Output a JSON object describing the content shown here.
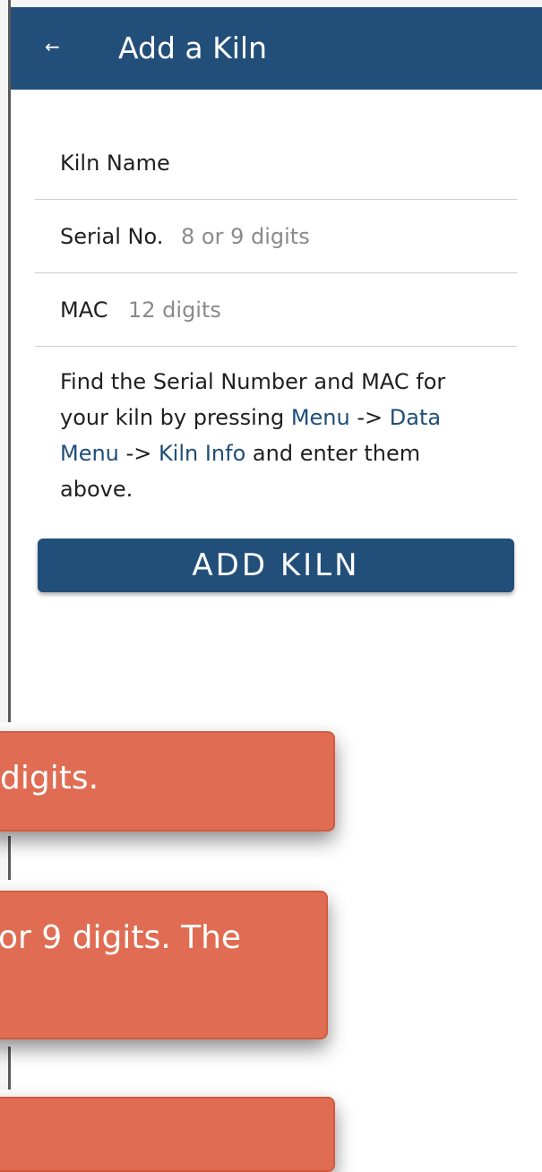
{
  "header": {
    "back_icon": "arrow-left-icon",
    "back_glyph": "←",
    "title": "Add a Kiln"
  },
  "form": {
    "kiln_name_label": "Kiln Name",
    "serial_label": "Serial No.",
    "serial_placeholder": "8 or 9 digits",
    "mac_label": "MAC",
    "mac_placeholder": "12 digits"
  },
  "help": {
    "text_1": "Find the Serial Number and MAC for your kiln by pressing ",
    "link_menu": "Menu",
    "arrow_1": " -> ",
    "link_data_menu": "Data Menu",
    "arrow_2": " -> ",
    "link_kiln_info": "Kiln Info",
    "text_2": " and enter them above."
  },
  "add_button_label": "ADD KILN",
  "toasts": [
    {
      "text": "digits."
    },
    {
      "text": "or 9 digits. The"
    },
    {
      "text": ""
    }
  ],
  "colors": {
    "primary": "#224f7a",
    "link": "#1f4d78",
    "toast": "#e06d53"
  }
}
